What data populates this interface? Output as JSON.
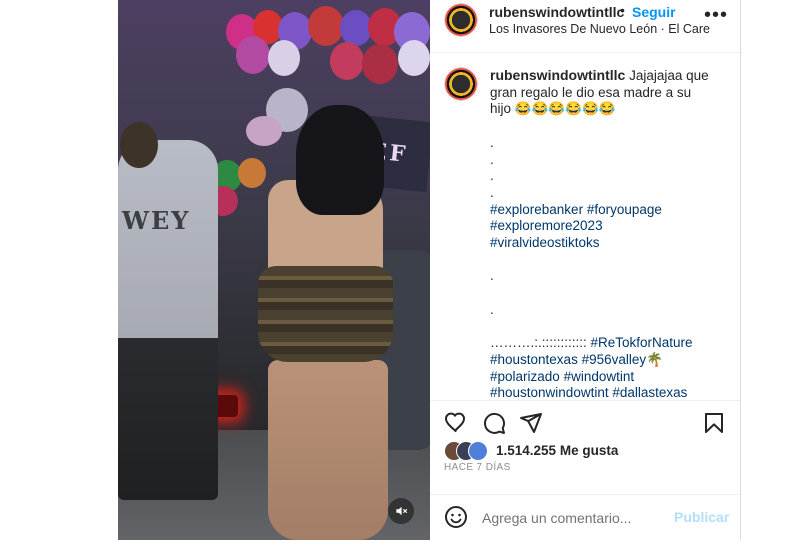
{
  "colors": {
    "link": "#00376b",
    "follow": "#0095f6",
    "publish_disabled": "#b2dffc",
    "muted_text": "#8e8e8e"
  },
  "media": {
    "shirt_text": "WEY",
    "banner_text": "EF",
    "mute_icon": "speaker-muted-icon"
  },
  "header": {
    "username": "rubenswindowtintllc",
    "separator": "•",
    "follow_label": "Seguir",
    "location": "Los Invasores De Nuevo León · El Care",
    "more_label": "•••"
  },
  "caption": {
    "username": "rubenswindowtintllc",
    "text_line1": "Jajajajaa que",
    "text_line2": "gran regalo le dio esa madre a su",
    "text_line3": "hijo 😂😂😂😂😂😂",
    "dot1": ".",
    "dot2": ".",
    "dot3": ".",
    "dot4": ".",
    "tag1": "#explorebanker",
    "tag2": "#foryoupage",
    "tag3": "#exploremore2023",
    "tag4": "#viralvideostiktoks",
    "dot5": ".",
    "dot6": ".",
    "dots_line": "……….:.:::::::::::: ",
    "tag5": "#ReTokforNature",
    "tag6": "#houstontexas",
    "tag7": "#956valley🌴",
    "tag8": "#polarizado",
    "tag9": "#windowtint",
    "tag10": "#houstonwindowtint",
    "tag11": "#dallastexas"
  },
  "engagement": {
    "likes_count": "1.514.255",
    "likes_label": "Me gusta",
    "time_ago": "HACE 7 DÍAS"
  },
  "comment": {
    "placeholder": "Agrega un comentario...",
    "publish_label": "Publicar"
  }
}
